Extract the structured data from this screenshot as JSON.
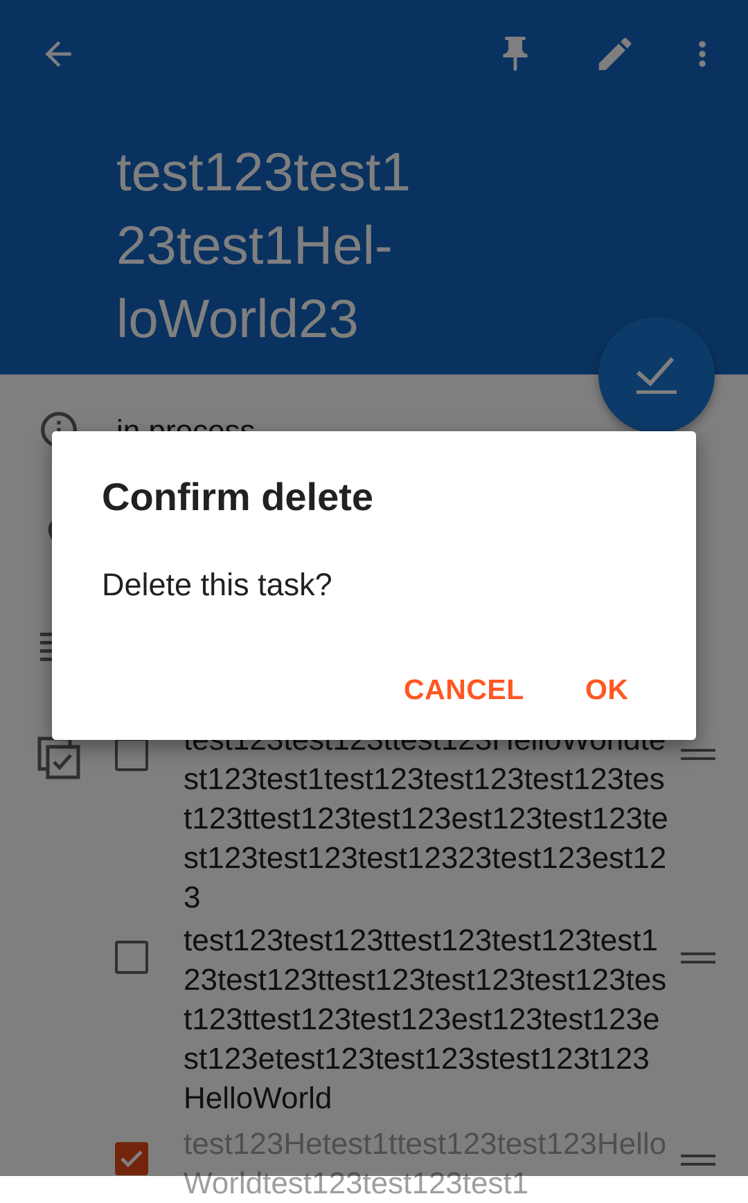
{
  "header": {
    "title": "test123test123test1HelloWorld23",
    "title_lines": [
      "test123test1",
      "23test1Hel-",
      "loWorld23"
    ],
    "icons": [
      "arrow-back-icon",
      "pin-icon",
      "edit-icon",
      "more-vert-icon"
    ]
  },
  "status": {
    "text": "in process"
  },
  "checklist": {
    "items": [
      {
        "checked": false,
        "text": "test123test123ttest123HelloWorldtest123test1test123test123test123test123ttest123test123est123test123test123test123test12323test123est123"
      },
      {
        "checked": false,
        "text": "test123test123ttest123test123test123test123ttest123test123test123test123ttest123test123est123test123est123etest123test123stest123t123HelloWorld"
      },
      {
        "checked": true,
        "text": "test123Hetest1ttest123test123HelloWorldtest123test123test1"
      }
    ]
  },
  "dialog": {
    "title": "Confirm delete",
    "message": "Delete this task?",
    "cancel_label": "CANCEL",
    "ok_label": "OK"
  },
  "colors": {
    "header": "#1565c0",
    "fab": "#1976d2",
    "accent": "#ff5722",
    "scrim": "rgba(0,0,0,0.5)"
  }
}
